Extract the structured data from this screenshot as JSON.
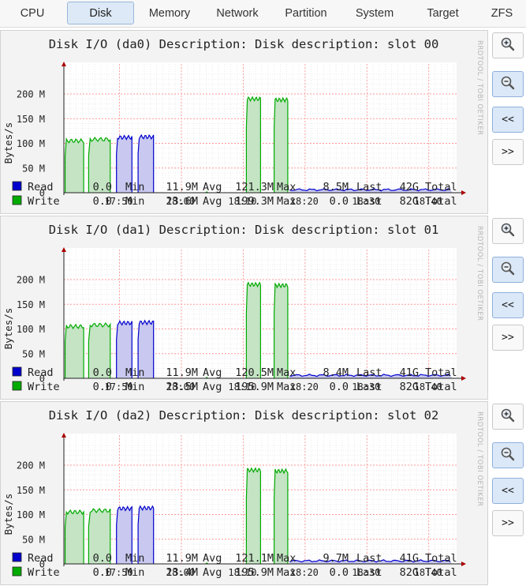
{
  "tabs": [
    {
      "label": "CPU",
      "active": false
    },
    {
      "label": "Disk",
      "active": true
    },
    {
      "label": "Memory",
      "active": false
    },
    {
      "label": "Network",
      "active": false
    },
    {
      "label": "Partition",
      "active": false
    },
    {
      "label": "System",
      "active": false
    },
    {
      "label": "Target",
      "active": false
    },
    {
      "label": "ZFS",
      "active": false
    }
  ],
  "buttons": [
    {
      "name": "zoom-in-button",
      "icon": "zoom-in-icon",
      "style": "plain"
    },
    {
      "name": "zoom-out-button",
      "icon": "zoom-out-icon",
      "style": "active"
    },
    {
      "name": "scroll-back-button",
      "label": "<<",
      "style": "active"
    },
    {
      "name": "scroll-forward-button",
      "label": ">>",
      "style": "plain"
    }
  ],
  "graph_common": {
    "ylabel": "Bytes/s",
    "watermark": "RRDTOOL / TOBI OETIKER",
    "x_ticks": [
      "17:50",
      "18:00",
      "18:10",
      "18:20",
      "18:30",
      "18:40"
    ],
    "y_ticks": [
      "200 M",
      "150 M",
      "100 M",
      "50 M",
      "0"
    ],
    "colors": {
      "read": "#0000cc",
      "read_fill": "#c8c8f0",
      "write": "#00aa00",
      "write_fill": "#c4e4c4",
      "grid": "#ff9999"
    }
  },
  "panels": [
    {
      "title": "Disk I/O (da0) Description: Disk description: slot 00",
      "legend": [
        {
          "name": "Read",
          "color": "#0000cc",
          "min": "0.0",
          "avg": "11.9M",
          "max": "121.3M",
          "last": "8.5M",
          "total": "42G"
        },
        {
          "name": "Write",
          "color": "#00aa00",
          "min": "0.0",
          "avg": "23.6M",
          "max": "199.3M",
          "last": "0.0",
          "total": "82G"
        }
      ]
    },
    {
      "title": "Disk I/O (da1) Description: Disk description: slot 01",
      "legend": [
        {
          "name": "Read",
          "color": "#0000cc",
          "min": "0.0",
          "avg": "11.9M",
          "max": "120.5M",
          "last": "8.4M",
          "total": "41G"
        },
        {
          "name": "Write",
          "color": "#00aa00",
          "min": "0.0",
          "avg": "23.5M",
          "max": "195.9M",
          "last": "0.0",
          "total": "82G"
        }
      ]
    },
    {
      "title": "Disk I/O (da2) Description: Disk description: slot 02",
      "legend": [
        {
          "name": "Read",
          "color": "#0000cc",
          "min": "0.0",
          "avg": "11.9M",
          "max": "121.1M",
          "last": "9.7M",
          "total": "41G"
        },
        {
          "name": "Write",
          "color": "#00aa00",
          "min": "0.0",
          "avg": "23.4M",
          "max": "195.9M",
          "last": "0.0",
          "total": "82G"
        }
      ]
    }
  ]
}
